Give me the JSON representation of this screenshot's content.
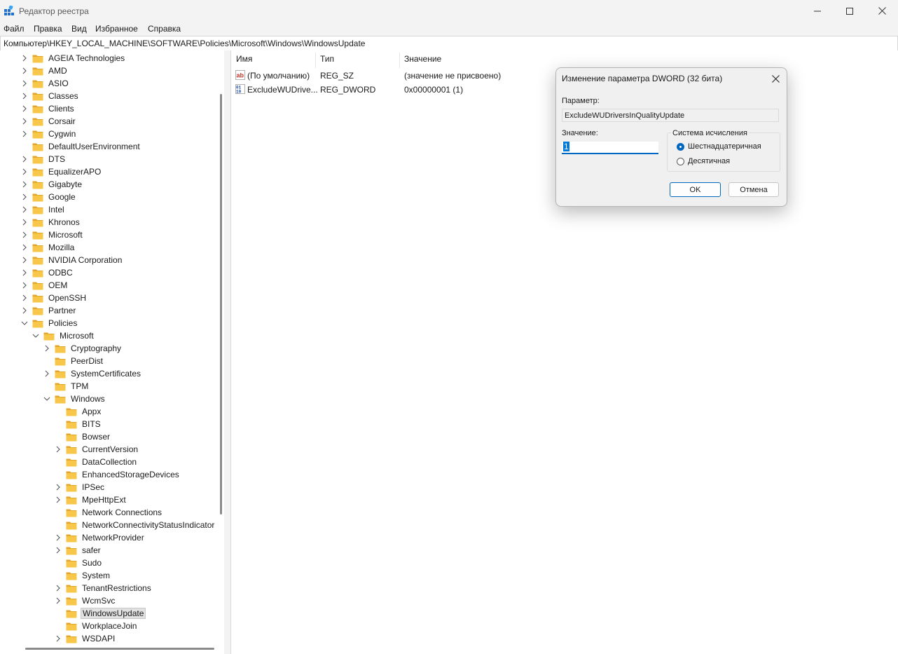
{
  "window": {
    "title": "Редактор реестра"
  },
  "menu": {
    "items": [
      "Файл",
      "Правка",
      "Вид",
      "Избранное",
      "Справка"
    ]
  },
  "address": {
    "path": "Компьютер\\HKEY_LOCAL_MACHINE\\SOFTWARE\\Policies\\Microsoft\\Windows\\WindowsUpdate"
  },
  "tree": {
    "items": [
      {
        "label": "AGEIA Technologies",
        "level": 0,
        "expander": "collapsed"
      },
      {
        "label": "AMD",
        "level": 0,
        "expander": "collapsed"
      },
      {
        "label": "ASIO",
        "level": 0,
        "expander": "collapsed"
      },
      {
        "label": "Classes",
        "level": 0,
        "expander": "collapsed"
      },
      {
        "label": "Clients",
        "level": 0,
        "expander": "collapsed"
      },
      {
        "label": "Corsair",
        "level": 0,
        "expander": "collapsed"
      },
      {
        "label": "Cygwin",
        "level": 0,
        "expander": "collapsed"
      },
      {
        "label": "DefaultUserEnvironment",
        "level": 0,
        "expander": "none"
      },
      {
        "label": "DTS",
        "level": 0,
        "expander": "collapsed"
      },
      {
        "label": "EqualizerAPO",
        "level": 0,
        "expander": "collapsed"
      },
      {
        "label": "Gigabyte",
        "level": 0,
        "expander": "collapsed"
      },
      {
        "label": "Google",
        "level": 0,
        "expander": "collapsed"
      },
      {
        "label": "Intel",
        "level": 0,
        "expander": "collapsed"
      },
      {
        "label": "Khronos",
        "level": 0,
        "expander": "collapsed"
      },
      {
        "label": "Microsoft",
        "level": 0,
        "expander": "collapsed"
      },
      {
        "label": "Mozilla",
        "level": 0,
        "expander": "collapsed"
      },
      {
        "label": "NVIDIA Corporation",
        "level": 0,
        "expander": "collapsed"
      },
      {
        "label": "ODBC",
        "level": 0,
        "expander": "collapsed"
      },
      {
        "label": "OEM",
        "level": 0,
        "expander": "collapsed"
      },
      {
        "label": "OpenSSH",
        "level": 0,
        "expander": "collapsed"
      },
      {
        "label": "Partner",
        "level": 0,
        "expander": "collapsed"
      },
      {
        "label": "Policies",
        "level": 0,
        "expander": "expanded"
      },
      {
        "label": "Microsoft",
        "level": 1,
        "expander": "expanded"
      },
      {
        "label": "Cryptography",
        "level": 2,
        "expander": "collapsed"
      },
      {
        "label": "PeerDist",
        "level": 2,
        "expander": "none"
      },
      {
        "label": "SystemCertificates",
        "level": 2,
        "expander": "collapsed"
      },
      {
        "label": "TPM",
        "level": 2,
        "expander": "none"
      },
      {
        "label": "Windows",
        "level": 2,
        "expander": "expanded"
      },
      {
        "label": "Appx",
        "level": 3,
        "expander": "none"
      },
      {
        "label": "BITS",
        "level": 3,
        "expander": "none"
      },
      {
        "label": "Bowser",
        "level": 3,
        "expander": "none"
      },
      {
        "label": "CurrentVersion",
        "level": 3,
        "expander": "collapsed"
      },
      {
        "label": "DataCollection",
        "level": 3,
        "expander": "none"
      },
      {
        "label": "EnhancedStorageDevices",
        "level": 3,
        "expander": "none"
      },
      {
        "label": "IPSec",
        "level": 3,
        "expander": "collapsed"
      },
      {
        "label": "MpeHttpExt",
        "level": 3,
        "expander": "collapsed"
      },
      {
        "label": "Network Connections",
        "level": 3,
        "expander": "none"
      },
      {
        "label": "NetworkConnectivityStatusIndicator",
        "level": 3,
        "expander": "none"
      },
      {
        "label": "NetworkProvider",
        "level": 3,
        "expander": "collapsed"
      },
      {
        "label": "safer",
        "level": 3,
        "expander": "collapsed"
      },
      {
        "label": "Sudo",
        "level": 3,
        "expander": "none"
      },
      {
        "label": "System",
        "level": 3,
        "expander": "none"
      },
      {
        "label": "TenantRestrictions",
        "level": 3,
        "expander": "collapsed"
      },
      {
        "label": "WcmSvc",
        "level": 3,
        "expander": "collapsed"
      },
      {
        "label": "WindowsUpdate",
        "level": 3,
        "expander": "none",
        "selected": true
      },
      {
        "label": "WorkplaceJoin",
        "level": 3,
        "expander": "none"
      },
      {
        "label": "WSDAPI",
        "level": 3,
        "expander": "collapsed"
      }
    ]
  },
  "list": {
    "columns": {
      "name": "Имя",
      "type": "Тип",
      "value": "Значение"
    },
    "rows": [
      {
        "name": "(По умолчанию)",
        "type": "REG_SZ",
        "value": "(значение не присвоено)",
        "icon": "string-value-icon"
      },
      {
        "name": "ExcludeWUDrive...",
        "type": "REG_DWORD",
        "value": "0x00000001 (1)",
        "icon": "binary-value-icon"
      }
    ]
  },
  "dialog": {
    "title": "Изменение параметра DWORD (32 бита)",
    "param_label": "Параметр:",
    "param_value": "ExcludeWUDriversInQualityUpdate",
    "value_label": "Значение:",
    "value": "1",
    "radix_label": "Система исчисления",
    "radix_hex": "Шестнадцатеричная",
    "radix_dec": "Десятичная",
    "radix_selected": "hex",
    "ok": "OK",
    "cancel": "Отмена"
  },
  "colors": {
    "accent": "#0067c0",
    "folder": "#f8c74a",
    "folder_dark": "#e2a72a"
  }
}
